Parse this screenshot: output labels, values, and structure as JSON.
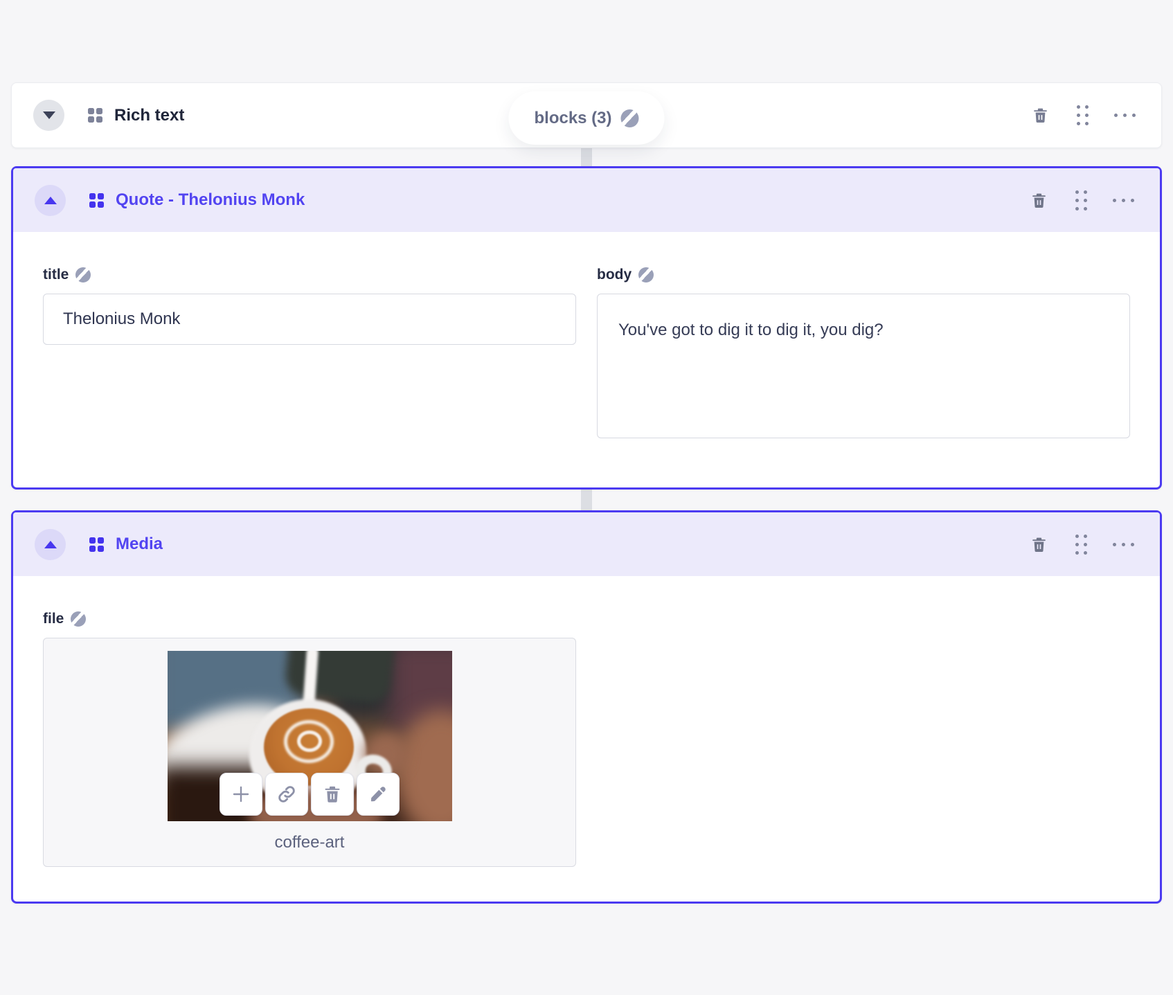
{
  "array_field": {
    "label": "blocks (3)",
    "icon": "globe-icon"
  },
  "colors": {
    "page_bg": "#f6f6f8",
    "accent_border": "#4b3af1",
    "accent_text": "#5244f1",
    "header_bg": "#eceafb",
    "connector": "#dcdee3",
    "icon_gray": "#81859c"
  },
  "header_actions": [
    {
      "icon": "trash-icon"
    },
    {
      "icon": "drag-handle-icon"
    },
    {
      "icon": "ellipsis-icon"
    }
  ],
  "blocks": [
    {
      "name": "Rich text",
      "state": "collapsed"
    },
    {
      "name": "Quote - Thelonius Monk",
      "state": "expanded",
      "fields": [
        {
          "label": "title",
          "value": "Thelonius Monk",
          "translatable_icon": "globe-icon"
        },
        {
          "label": "body",
          "value": "You've got to dig it to dig it, you dig?",
          "translatable_icon": "globe-icon"
        }
      ]
    },
    {
      "name": "Media",
      "state": "expanded",
      "fields": [
        {
          "label": "file",
          "file_name": "coffee-art",
          "translatable_icon": "globe-icon"
        }
      ]
    }
  ],
  "file_toolbar": [
    {
      "icon": "plus-icon"
    },
    {
      "icon": "link-icon"
    },
    {
      "icon": "trash-icon"
    },
    {
      "icon": "pencil-icon"
    }
  ]
}
